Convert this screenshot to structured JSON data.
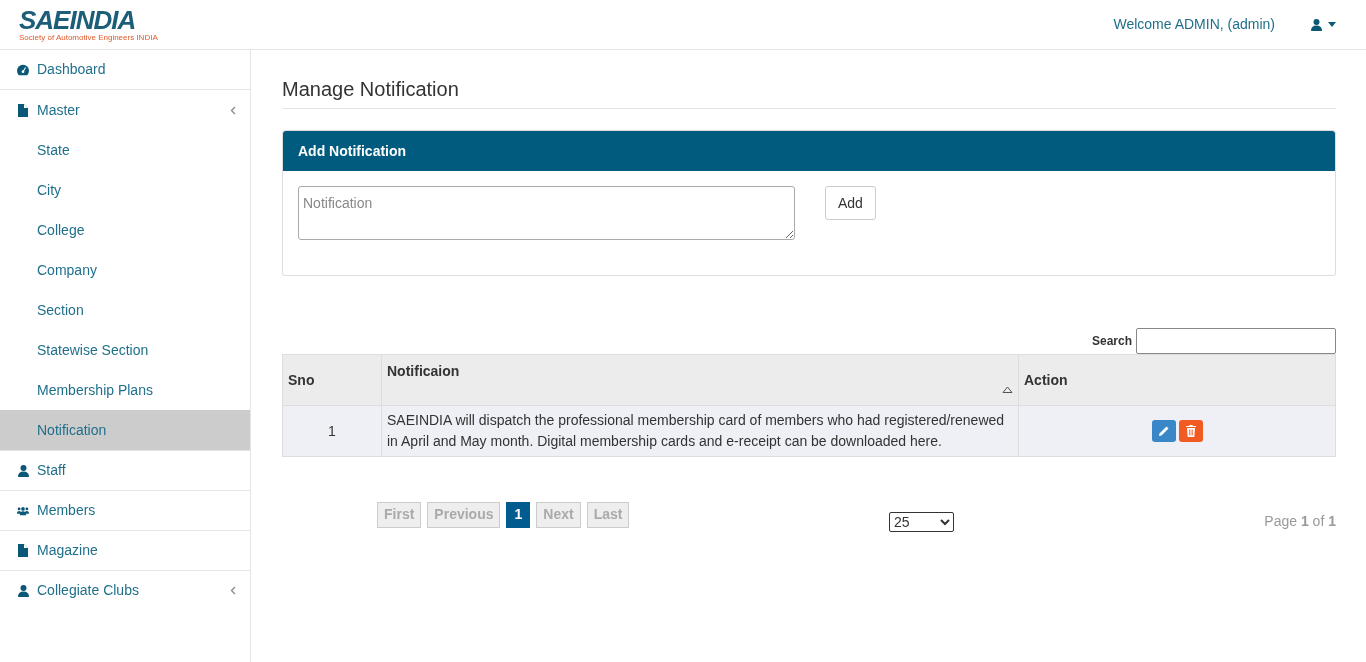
{
  "header": {
    "logo_title": "SAEINDIA",
    "logo_subtitle": "Society of Automotive Engineers INDIA",
    "welcome": "Welcome ADMIN, (admin)"
  },
  "sidebar": {
    "items": [
      {
        "kind": "link",
        "label": "Dashboard",
        "selected": false
      },
      {
        "kind": "menu",
        "label": "Master",
        "expanded": true,
        "selected": false,
        "children": [
          {
            "label": "State",
            "selected": false
          },
          {
            "label": "City",
            "selected": false
          },
          {
            "label": "College",
            "selected": false
          },
          {
            "label": "Company",
            "selected": false
          },
          {
            "label": "Section",
            "selected": false
          },
          {
            "label": "Statewise Section",
            "selected": false
          },
          {
            "label": "Membership Plans",
            "selected": false
          },
          {
            "label": "Notification",
            "selected": true
          }
        ]
      },
      {
        "kind": "link",
        "label": "Staff",
        "selected": false
      },
      {
        "kind": "link",
        "label": "Members",
        "selected": false
      },
      {
        "kind": "link",
        "label": "Magazine",
        "selected": false
      },
      {
        "kind": "menu",
        "label": "Collegiate Clubs",
        "selected": false
      }
    ]
  },
  "page_title": "Manage Notification",
  "form": {
    "title": "Add Notification",
    "placeholder": "Notification",
    "button": "Add"
  },
  "table": {
    "search_label": "Search",
    "columns": [
      "Sno",
      "Notificaion",
      "Action"
    ],
    "rows": [
      {
        "sno": "1",
        "text": "SAEINDIA will dispatch the professional membership card of members who had registered/renewed in April and May month. Digital membership cards and e-receipt can be downloaded here."
      }
    ]
  },
  "pagination": {
    "buttons": [
      {
        "label": "First",
        "selected": false
      },
      {
        "label": "Previous",
        "selected": false
      },
      {
        "label": "1",
        "selected": true
      },
      {
        "label": "Next",
        "selected": false
      },
      {
        "label": "Last",
        "selected": false
      }
    ],
    "page_size": "25",
    "page_info": "Page **1** of **1**"
  }
}
